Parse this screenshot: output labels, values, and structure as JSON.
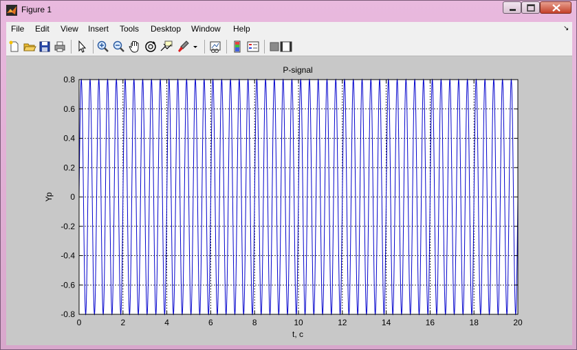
{
  "window": {
    "title": "Figure 1"
  },
  "menu": [
    "File",
    "Edit",
    "View",
    "Insert",
    "Tools",
    "Desktop",
    "Window",
    "Help"
  ],
  "toolbar": {
    "icons": [
      "new-figure-icon",
      "open-file-icon",
      "save-icon",
      "print-icon",
      "pointer-icon",
      "zoom-in-icon",
      "zoom-out-icon",
      "pan-icon",
      "rotate-3d-icon",
      "data-cursor-icon",
      "brush-icon",
      "brush-dropdown-icon",
      "link-plot-icon",
      "colorbar-icon",
      "legend-icon",
      "hide-plot-tools-icon",
      "show-plot-tools-icon"
    ]
  },
  "colors": {
    "line": "#0000cc",
    "axes_bg": "#ffffff",
    "figure_bg": "#c8c8c8"
  },
  "chart_data": {
    "type": "line",
    "title": "P-signal",
    "xlabel": "t, c",
    "ylabel": "Yp",
    "xlim": [
      0,
      20
    ],
    "ylim": [
      -0.8,
      0.8
    ],
    "xticks": [
      0,
      2,
      4,
      6,
      8,
      10,
      12,
      14,
      16,
      18,
      20
    ],
    "yticks": [
      -0.8,
      -0.6,
      -0.4,
      -0.2,
      0,
      0.2,
      0.4,
      0.6,
      0.8
    ],
    "xtick_labels": [
      "0",
      "2",
      "4",
      "6",
      "8",
      "10",
      "12",
      "14",
      "16",
      "18",
      "20"
    ],
    "ytick_labels": [
      "-0.8",
      "-0.6",
      "-0.4",
      "-0.2",
      "0",
      "0.2",
      "0.4",
      "0.6",
      "0.8"
    ],
    "grid": true,
    "series": [
      {
        "function": "sine",
        "amplitude": 0.8,
        "frequency_hz": 2.5,
        "t_start": 0,
        "t_end": 20
      }
    ]
  }
}
